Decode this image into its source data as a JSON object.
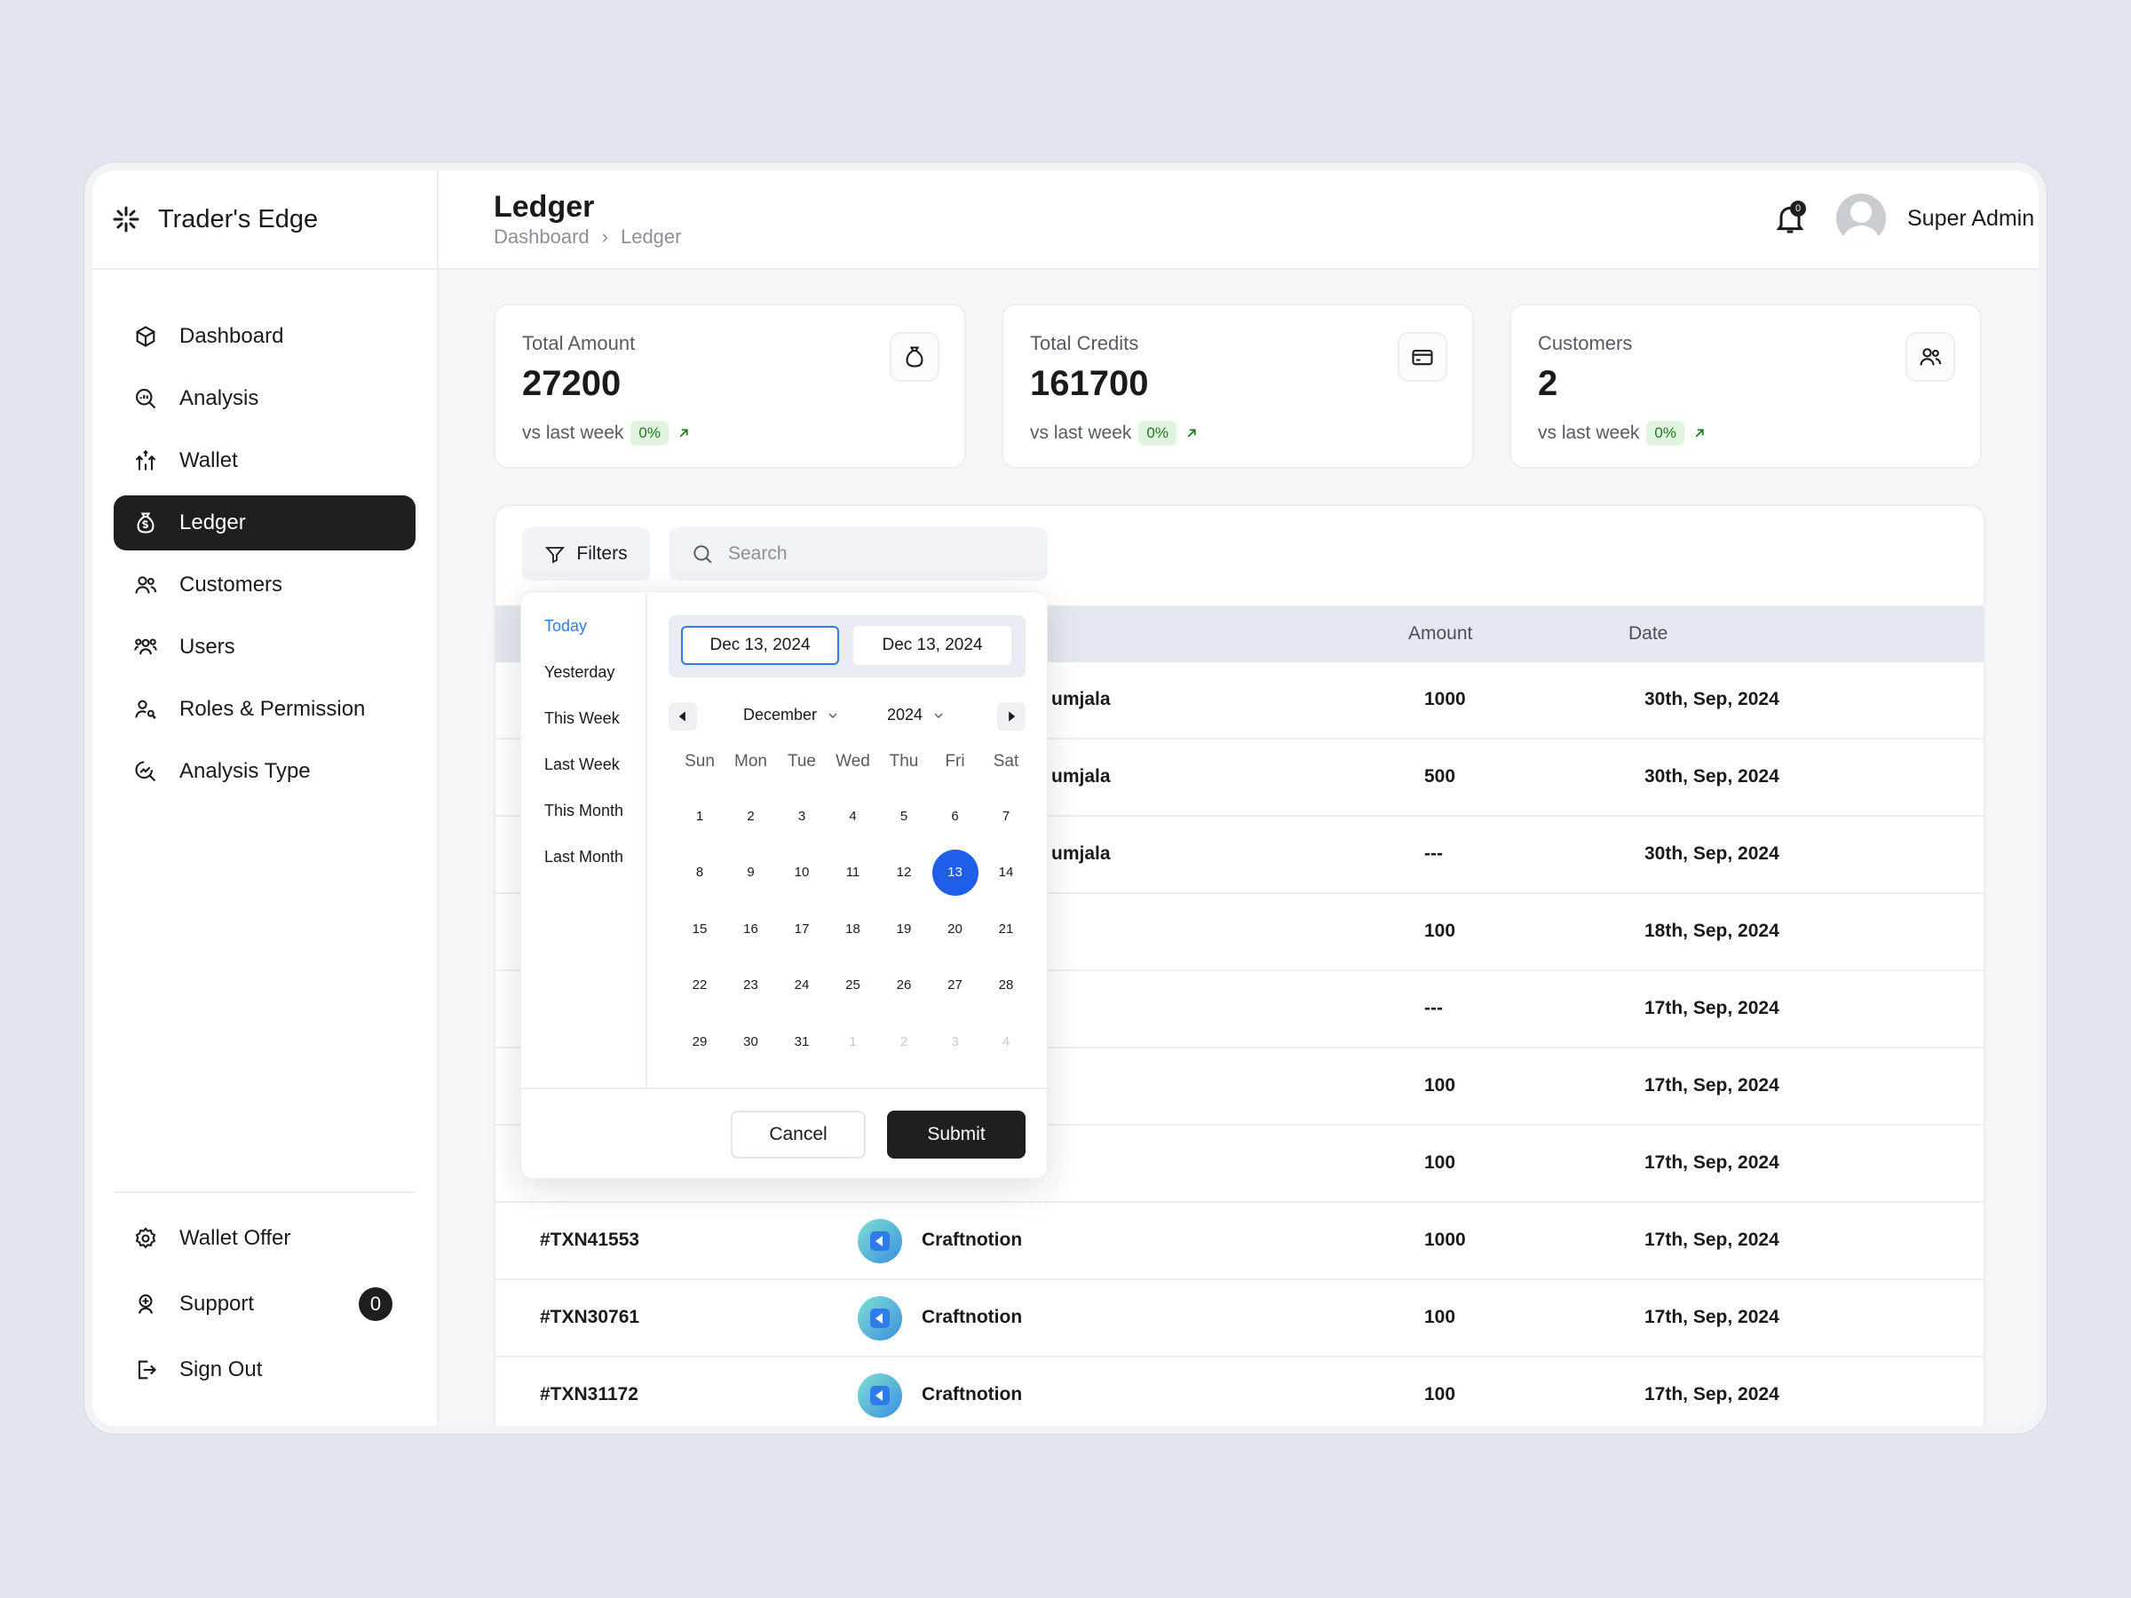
{
  "brand": {
    "name": "Trader's Edge"
  },
  "sidebar": {
    "items": [
      {
        "label": "Dashboard",
        "icon": "cube-icon"
      },
      {
        "label": "Analysis",
        "icon": "magnify-chart-icon"
      },
      {
        "label": "Wallet",
        "icon": "wallet-transfer-icon"
      },
      {
        "label": "Ledger",
        "icon": "money-bag-icon",
        "active": true
      },
      {
        "label": "Customers",
        "icon": "customers-icon"
      },
      {
        "label": "Users",
        "icon": "users-icon"
      },
      {
        "label": "Roles & Permission",
        "icon": "user-key-icon"
      },
      {
        "label": "Analysis Type",
        "icon": "analysis-type-icon"
      }
    ],
    "bottom": [
      {
        "label": "Wallet Offer",
        "icon": "gear-icon"
      },
      {
        "label": "Support",
        "icon": "support-icon",
        "badge": "0"
      },
      {
        "label": "Sign Out",
        "icon": "sign-out-icon"
      }
    ]
  },
  "header": {
    "title": "Ledger",
    "breadcrumb": [
      "Dashboard",
      "Ledger"
    ],
    "notifications": "0",
    "user_name": "Super Admin"
  },
  "stats": [
    {
      "label": "Total Amount",
      "value": "27200",
      "foot": "vs last week",
      "change": "0%",
      "icon": "money-bag-icon"
    },
    {
      "label": "Total Credits",
      "value": "161700",
      "foot": "vs last week",
      "change": "0%",
      "icon": "card-icon"
    },
    {
      "label": "Customers",
      "value": "2",
      "foot": "vs last week",
      "change": "0%",
      "icon": "customers-icon"
    }
  ],
  "toolbar": {
    "filters_label": "Filters",
    "search_placeholder": "Search"
  },
  "table": {
    "headers": {
      "amount": "Amount",
      "date": "Date"
    },
    "rows": [
      {
        "txn": "",
        "name": "umjala",
        "amount": "1000",
        "date": "30th, Sep, 2024"
      },
      {
        "txn": "",
        "name": "umjala",
        "amount": "500",
        "date": "30th, Sep, 2024"
      },
      {
        "txn": "",
        "name": "umjala",
        "amount": "---",
        "date": "30th, Sep, 2024"
      },
      {
        "txn": "",
        "name": "",
        "amount": "100",
        "date": "18th, Sep, 2024"
      },
      {
        "txn": "",
        "name": "",
        "amount": "---",
        "date": "17th, Sep, 2024"
      },
      {
        "txn": "",
        "name": "",
        "amount": "100",
        "date": "17th, Sep, 2024"
      },
      {
        "txn": "",
        "name": "",
        "amount": "100",
        "date": "17th, Sep, 2024"
      },
      {
        "txn": "#TXN41553",
        "name": "Craftnotion",
        "amount": "1000",
        "date": "17th, Sep, 2024"
      },
      {
        "txn": "#TXN30761",
        "name": "Craftnotion",
        "amount": "100",
        "date": "17th, Sep, 2024"
      },
      {
        "txn": "#TXN31172",
        "name": "Craftnotion",
        "amount": "100",
        "date": "17th, Sep, 2024"
      }
    ]
  },
  "datepicker": {
    "presets": [
      "Today",
      "Yesterday",
      "This Week",
      "Last Week",
      "This Month",
      "Last Month"
    ],
    "selected_preset": "Today",
    "start": "Dec 13, 2024",
    "end": "Dec 13, 2024",
    "month": "December",
    "year": "2024",
    "weekdays": [
      "Sun",
      "Mon",
      "Tue",
      "Wed",
      "Thu",
      "Fri",
      "Sat"
    ],
    "days": [
      "1",
      "2",
      "3",
      "4",
      "5",
      "6",
      "7",
      "8",
      "9",
      "10",
      "11",
      "12",
      "13",
      "14",
      "15",
      "16",
      "17",
      "18",
      "19",
      "20",
      "21",
      "22",
      "23",
      "24",
      "25",
      "26",
      "27",
      "28",
      "29",
      "30",
      "31",
      "1",
      "2",
      "3",
      "4"
    ],
    "selected_day": "13",
    "cancel_label": "Cancel",
    "submit_label": "Submit"
  }
}
